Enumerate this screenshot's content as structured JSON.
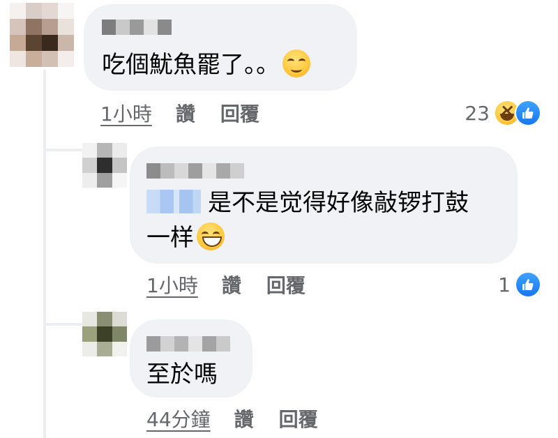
{
  "colors": {
    "bubble_bg": "#f0f2f5",
    "meta_text": "#65676b",
    "like_blue": "#1877f2"
  },
  "comments": [
    {
      "text": "吃個魷魚罷了。。",
      "trailing_emoji": "relieved-face-emoji",
      "time": "1小時",
      "like_label": "讚",
      "reply_label": "回覆",
      "reaction_count": "23",
      "reaction_icons": [
        "haha-icon",
        "like-icon"
      ]
    },
    {
      "mention_hidden": true,
      "text_line1": "是不是觉得好像敲锣打鼓",
      "text_line2": "一样",
      "trailing_emoji": "grinning-face-emoji",
      "time": "1小時",
      "like_label": "讚",
      "reply_label": "回覆",
      "reaction_count": "1",
      "reaction_icons": [
        "like-icon"
      ]
    },
    {
      "text": "至於嗎",
      "time": "44分鐘",
      "like_label": "讚",
      "reply_label": "回覆"
    }
  ]
}
